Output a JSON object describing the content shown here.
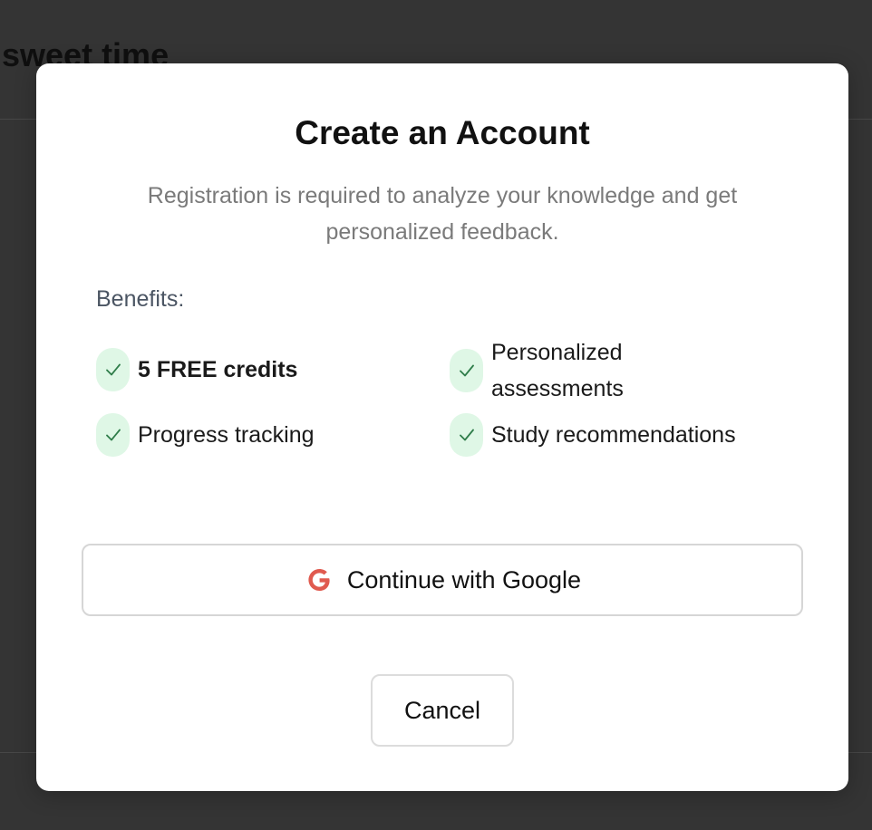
{
  "background": {
    "page_title": "r sweet time"
  },
  "modal": {
    "title": "Create an Account",
    "subtitle": "Registration is required to analyze your knowledge and get personalized feedback.",
    "benefits_heading": "Benefits:",
    "benefits": [
      {
        "label": "5 FREE credits",
        "icon": "checkmark-icon",
        "emphasis": true
      },
      {
        "label": "Personalized assessments",
        "icon": "checkmark-icon",
        "emphasis": false
      },
      {
        "label": "Progress tracking",
        "icon": "checkmark-icon",
        "emphasis": false
      },
      {
        "label": "Study recommendations",
        "icon": "checkmark-icon",
        "emphasis": false
      }
    ],
    "google_button": {
      "label": "Continue with Google",
      "icon": "google-icon"
    },
    "cancel_button": {
      "label": "Cancel"
    }
  },
  "colors": {
    "overlay": "#343434",
    "modal_bg": "#ffffff",
    "check_bg": "#dff7e6",
    "check_color": "#2f7d4a",
    "google_red": "#e05a4f",
    "subtitle": "#7a7a7a"
  }
}
